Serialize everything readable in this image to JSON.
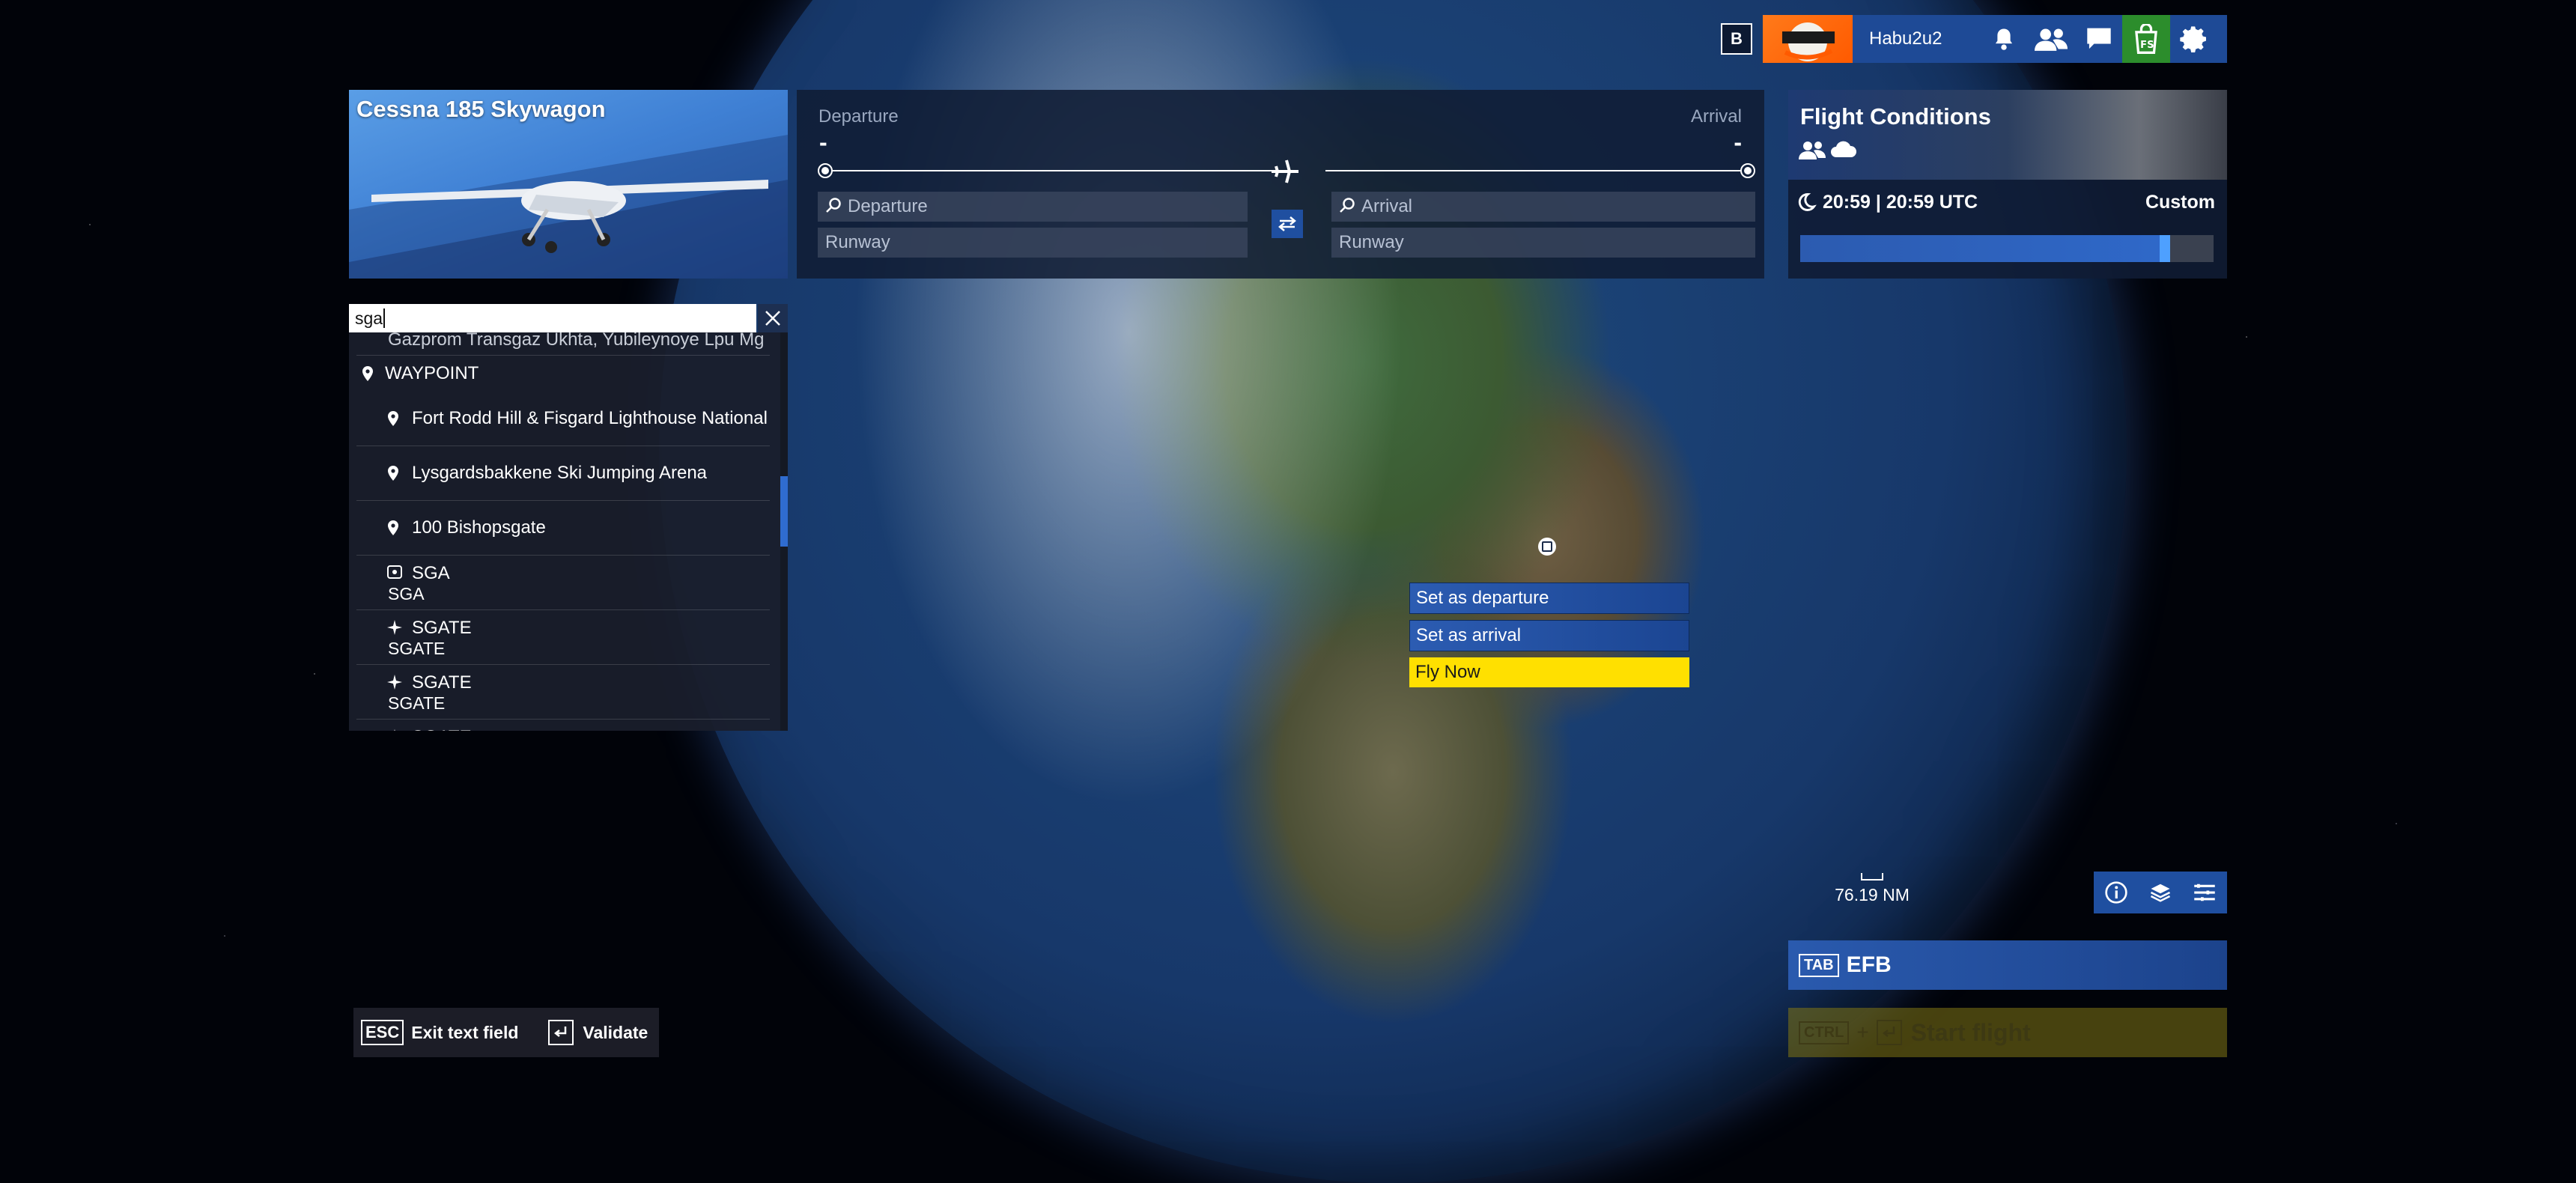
{
  "topbar": {
    "badge": "B",
    "username": "Habu2u2"
  },
  "aircraft": {
    "name": "Cessna 185 Skywagon"
  },
  "route": {
    "departure_label": "Departure",
    "arrival_label": "Arrival",
    "departure_value": "-",
    "arrival_value": "-",
    "departure_placeholder": "Departure",
    "arrival_placeholder": "Arrival",
    "runway_placeholder": "Runway"
  },
  "conditions": {
    "title": "Flight Conditions",
    "time": "20:59 | 20:59 UTC",
    "mode": "Custom",
    "slider_fraction": 0.87
  },
  "search": {
    "value": "sga",
    "results": [
      {
        "kind": "item",
        "icon": "none",
        "title": "Gazprom Transgaz Ukhta, Yubileynoye Lpu Mg"
      },
      {
        "kind": "header",
        "icon": "pin-icon",
        "title": "WAYPOINT"
      },
      {
        "kind": "item",
        "icon": "pin-icon",
        "title": "Fort Rodd Hill & Fisgard Lighthouse National"
      },
      {
        "kind": "item",
        "icon": "pin-icon",
        "title": "Lysgardsbakkene Ski Jumping Arena"
      },
      {
        "kind": "item",
        "icon": "pin-icon",
        "title": "100 Bishopsgate"
      },
      {
        "kind": "item2",
        "icon": "vor-icon",
        "title": "SGA",
        "subtitle": "SGA"
      },
      {
        "kind": "item2",
        "icon": "intersection-icon",
        "title": "SGATE",
        "subtitle": "SGATE"
      },
      {
        "kind": "item2",
        "icon": "intersection-icon",
        "title": "SGATE",
        "subtitle": "SGATE"
      },
      {
        "kind": "item2",
        "icon": "intersection-icon",
        "title": "SGATE",
        "subtitle": ""
      }
    ]
  },
  "context_menu": {
    "set_departure": "Set as departure",
    "set_arrival": "Set as arrival",
    "fly_now": "Fly Now"
  },
  "scale": {
    "distance": "76.19 NM"
  },
  "efb": {
    "key": "TAB",
    "label": "EFB"
  },
  "start": {
    "key1": "CTRL",
    "plus": "+",
    "label": "Start flight"
  },
  "hints": {
    "esc_key": "ESC",
    "esc_label": "Exit text field",
    "validate_label": "Validate"
  },
  "colors": {
    "accent_blue": "#1f4fa0",
    "fly_now_yellow": "#ffe000",
    "store_green": "#2c8d2c"
  }
}
